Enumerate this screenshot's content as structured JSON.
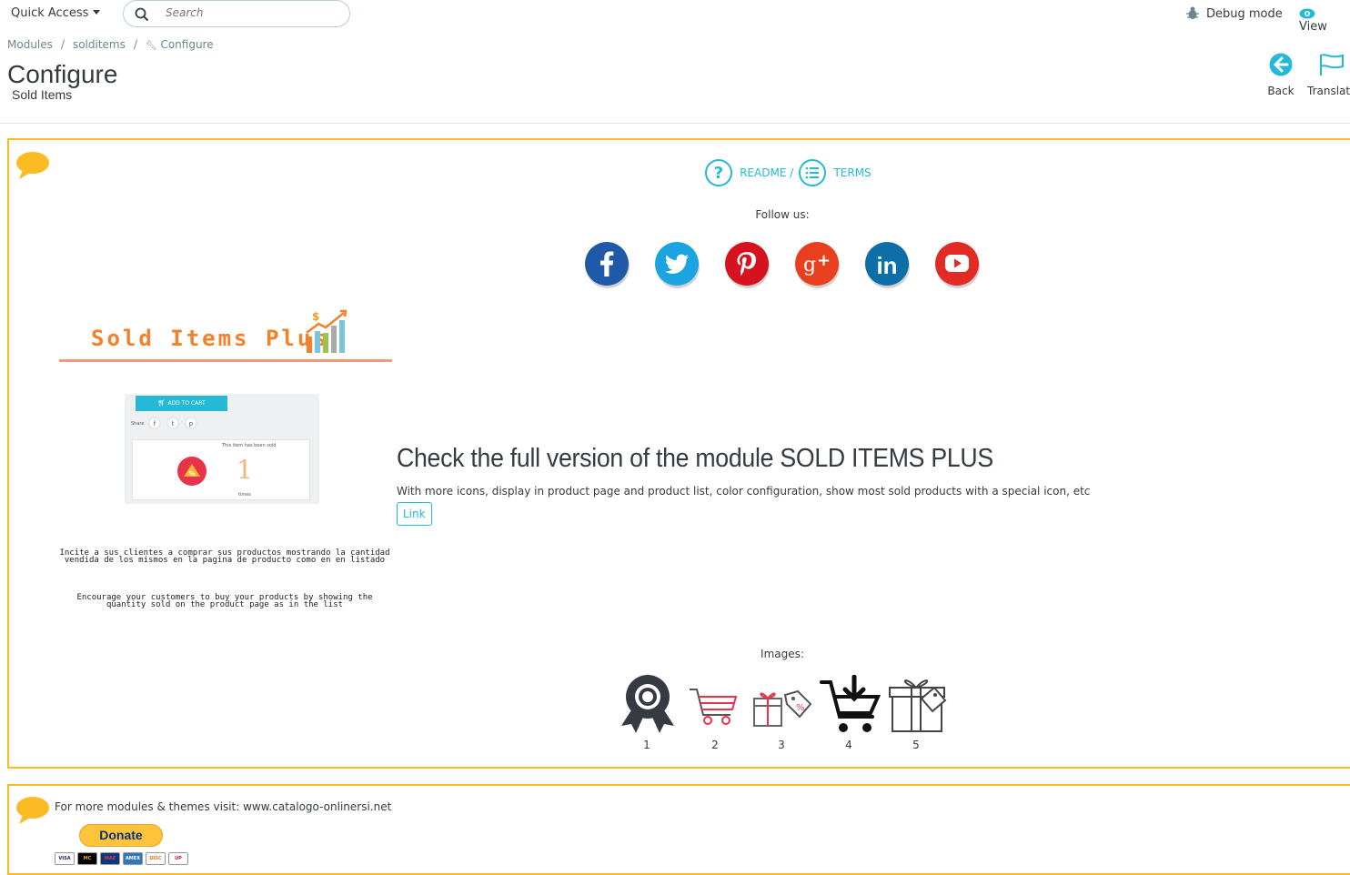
{
  "topbar": {
    "quick_access": "Quick Access",
    "search_placeholder": "Search",
    "debug_mode": "Debug mode",
    "view": "View"
  },
  "breadcrumb": [
    "Modules",
    "solditems",
    "Configure"
  ],
  "page": {
    "title": "Configure",
    "subtitle": "Sold Items"
  },
  "toolbar": {
    "back": "Back",
    "translate": "Translat"
  },
  "main_panel": {
    "readme": "README /",
    "terms": "TERMS",
    "follow_us": "Follow us:",
    "social": [
      {
        "name": "facebook",
        "color": "#1e5aa8"
      },
      {
        "name": "twitter",
        "color": "#1aa5e0"
      },
      {
        "name": "pinterest",
        "color": "#d6121f"
      },
      {
        "name": "google-plus",
        "color": "#e8401f"
      },
      {
        "name": "linkedin",
        "color": "#0e6fa8"
      },
      {
        "name": "youtube",
        "color": "#e32b26"
      }
    ],
    "banner": {
      "title": "Sold Items Plus",
      "add_to_cart": "ADD TO CART",
      "share": "Share",
      "sold_text": "This item has been sold",
      "sold_count": "1",
      "times": "times",
      "incite": "Incite a sus clientes a comprar sus productos mostrando la cantidad vendida de los mismos en la pagina de producto como en en listado",
      "encourage": "Encourage your customers to buy your products by showing the quantity sold on the product page as in the list"
    },
    "promo": {
      "heading": "Check the full version of the module SOLD ITEMS PLUS",
      "description": "With more icons, display in product page and product list, color configuration, show most sold products with a special icon, etc",
      "link_label": "Link"
    },
    "images_label": "Images:",
    "images": [
      {
        "number": "1",
        "icon": "award-ribbon-icon"
      },
      {
        "number": "2",
        "icon": "shopping-cart-icon"
      },
      {
        "number": "3",
        "icon": "gift-tag-icon"
      },
      {
        "number": "4",
        "icon": "cart-download-icon"
      },
      {
        "number": "5",
        "icon": "gift-box-icon"
      }
    ]
  },
  "footer_panel": {
    "text": "For more modules & themes visit: www.catalogo-onlinersi.net",
    "donate": "Donate",
    "cards": [
      "VISA",
      "MC",
      "MAE",
      "AMEX",
      "DISC",
      "UP"
    ]
  },
  "colors": {
    "accent": "#25b9d7",
    "panel_border": "#fbbb22",
    "bubble": "#fbbb22"
  }
}
